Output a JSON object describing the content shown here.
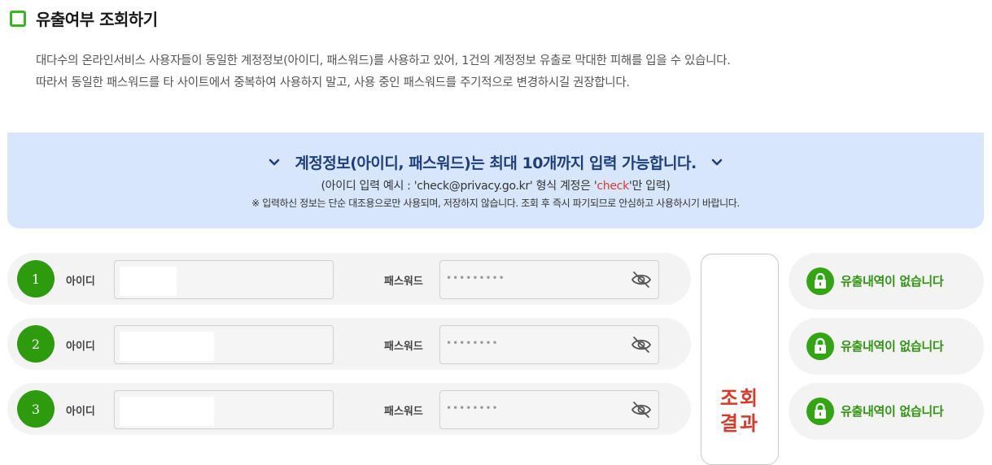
{
  "header": {
    "title": "유출여부 조회하기"
  },
  "description": [
    "대다수의 온라인서비스 사용자들이 동일한 계정정보(아이디, 패스워드)를 사용하고 있어, 1건의 계정정보 유출로 막대한 피해를 입을 수 있습니다.",
    "따라서 동일한 패스워드를 타 사이트에서 중복하여 사용하지 말고, 사용 중인 패스워드를 주기적으로 변경하시길 권장합니다."
  ],
  "banner": {
    "headline": "계정정보(아이디, 패스워드)는 최대 10개까지 입력 가능합니다.",
    "example_prefix": "(아이디 입력 예시 : 'check@privacy.go.kr' 형식 계정은 '",
    "example_highlight": "check",
    "example_suffix": "'만 입력)",
    "note": "※ 입력하신 정보는 단순 대조용으로만 사용되며, 저장하지 않습니다. 조회 후 즉시 파기되므로 안심하고 사용하시기 바랍니다."
  },
  "rows": [
    {
      "number": "1",
      "id_label": "아이디",
      "pw_label": "패스워드",
      "pw_mask": "•••••••••",
      "result": "유출내역이 없습니다"
    },
    {
      "number": "2",
      "id_label": "아이디",
      "pw_label": "패스워드",
      "pw_mask": "••••••••",
      "result": "유출내역이 없습니다"
    },
    {
      "number": "3",
      "id_label": "아이디",
      "pw_label": "패스워드",
      "pw_mask": "••••••••",
      "result": "유출내역이 없습니다"
    }
  ],
  "lookup_button": {
    "line1": "조회",
    "line2": "결과"
  },
  "icons": {
    "title": "checkbox-icon",
    "banner_left": "chevron-down-icon",
    "banner_right": "chevron-down-icon",
    "password_toggle": "eye-slash-icon",
    "result": "lock-icon"
  },
  "colors": {
    "accent_green": "#2e9a0e",
    "headline_blue": "#1e3f7d",
    "highlight_red": "#d63a2a",
    "banner_bg": "#d7e6fb"
  }
}
